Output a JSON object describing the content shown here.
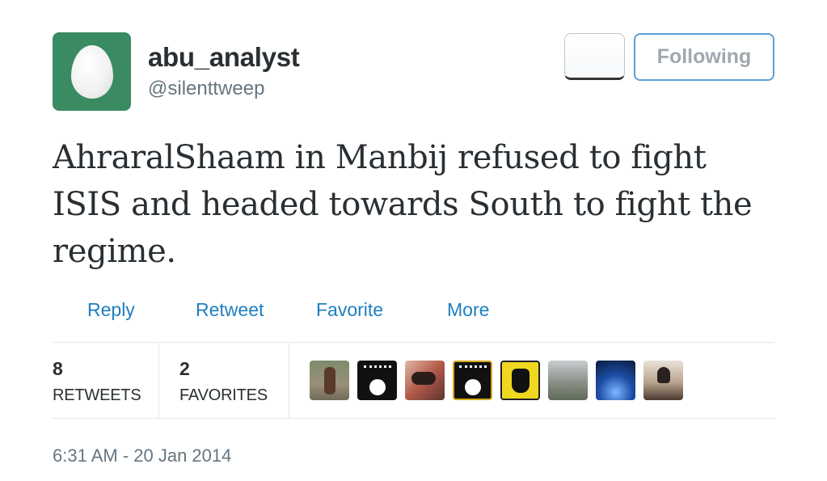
{
  "user": {
    "display_name": "abu_analyst",
    "screen_name": "@silenttweep",
    "avatar": "default-egg-avatar"
  },
  "header": {
    "follow_label": "Following"
  },
  "tweet": {
    "text": "AhraralShaam in Manbij refused to fight ISIS and headed towards South to fight the regime.",
    "timestamp": "6:31 AM - 20 Jan 2014"
  },
  "actions": {
    "reply": "Reply",
    "retweet": "Retweet",
    "favorite": "Favorite",
    "more": "More"
  },
  "stats": {
    "retweets_count": "8",
    "retweets_label": "RETWEETS",
    "favorites_count": "2",
    "favorites_label": "FAVORITES"
  },
  "colors": {
    "link": "#1e7fc0",
    "avatar_bg": "#3a8a62",
    "follow_border": "#5a9fd4"
  }
}
